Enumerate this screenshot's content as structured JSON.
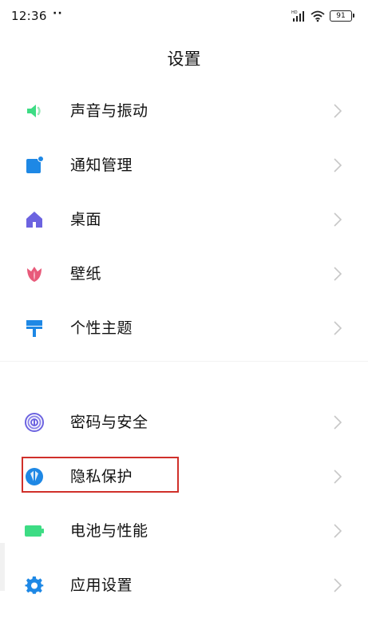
{
  "status_bar": {
    "time": "12:36",
    "dots": "··",
    "network_label": "HD",
    "battery_level": "91"
  },
  "page": {
    "title": "设置"
  },
  "groups": [
    {
      "items": [
        {
          "label": "声音与振动",
          "icon": "speaker-icon",
          "color": "#3ddc84"
        },
        {
          "label": "通知管理",
          "icon": "notification-icon",
          "color": "#1e88e5"
        },
        {
          "label": "桌面",
          "icon": "home-icon",
          "color": "#6c63e0"
        },
        {
          "label": "壁纸",
          "icon": "tulip-icon",
          "color": "#e85a7a"
        },
        {
          "label": "个性主题",
          "icon": "brush-icon",
          "color": "#1e88e5"
        }
      ]
    },
    {
      "items": [
        {
          "label": "密码与安全",
          "icon": "fingerprint-icon",
          "color": "#6c63e0"
        },
        {
          "label": "隐私保护",
          "icon": "shield-icon",
          "color": "#1e88e5",
          "highlighted": true
        },
        {
          "label": "电池与性能",
          "icon": "battery-icon",
          "color": "#3ddc84"
        },
        {
          "label": "应用设置",
          "icon": "gear-icon",
          "color": "#1e88e5"
        }
      ]
    }
  ],
  "highlight_color": "#d0302a"
}
